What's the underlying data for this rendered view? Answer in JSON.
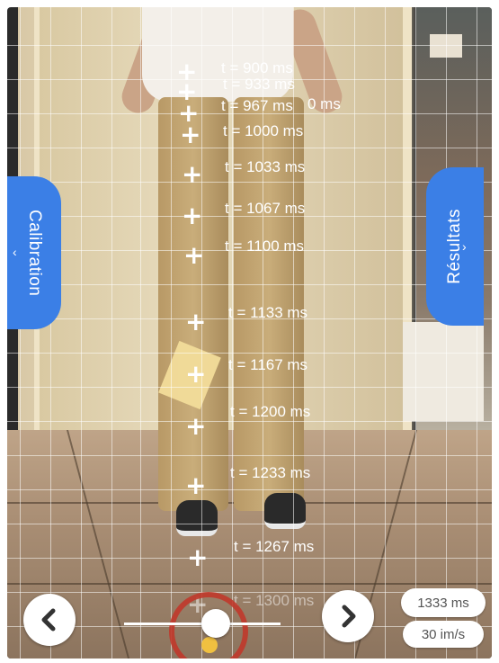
{
  "calibration_tab": {
    "label": "Calibration",
    "chevron": "‹"
  },
  "results_tab": {
    "label": "Résultats",
    "chevron": "›"
  },
  "timestamps": [
    {
      "label": "t = 900 ms"
    },
    {
      "label": "t = 933 ms"
    },
    {
      "label": "t = 967 ms"
    },
    {
      "label": "t = 1000 ms"
    },
    {
      "label": "t = 1033 ms"
    },
    {
      "label": "t = 1067 ms"
    },
    {
      "label": "t = 1100 ms"
    },
    {
      "label": "t = 1133 ms"
    },
    {
      "label": "t = 1167 ms"
    },
    {
      "label": "t = 1200 ms"
    },
    {
      "label": "t = 1233 ms"
    },
    {
      "label": "t = 1267 ms"
    },
    {
      "label": "t = 1300 ms"
    }
  ],
  "overlap_fragment": "0 ms",
  "controls": {
    "prev_icon": "chevron-left-icon",
    "next_icon": "chevron-right-icon",
    "current_time": "1333 ms",
    "frame_rate": "30 im/s"
  }
}
